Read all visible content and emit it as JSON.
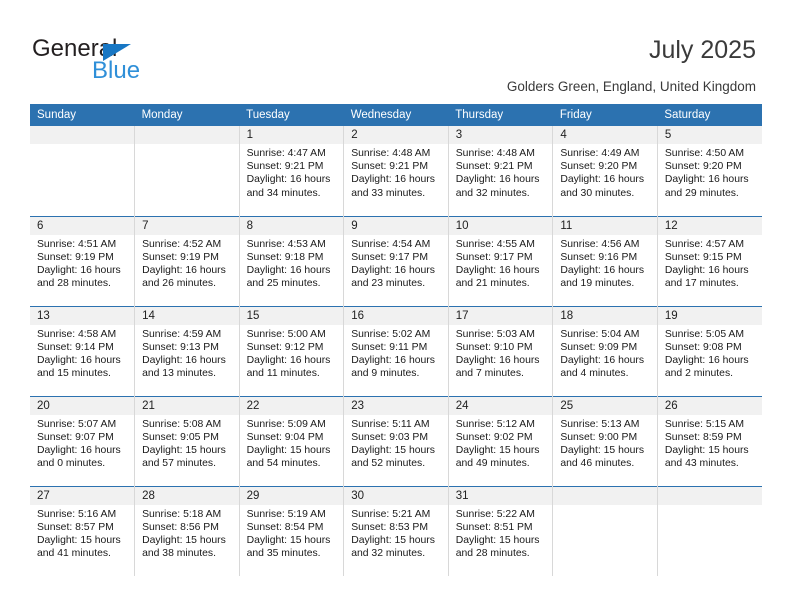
{
  "brand": {
    "name_top": "General",
    "name_bottom": "Blue",
    "triangle_icon": "blue-triangle-logo-icon",
    "color_dark": "#231f20",
    "color_blue": "#2f8fd8"
  },
  "header": {
    "title": "July 2025",
    "subtitle": "Golders Green, England, United Kingdom"
  },
  "theme": {
    "header_blue": "#2c72b0",
    "daynum_band": "#f1f1f1",
    "cell_border": "#d8d8d8"
  },
  "calendar": {
    "weekday_headers": [
      "Sunday",
      "Monday",
      "Tuesday",
      "Wednesday",
      "Thursday",
      "Friday",
      "Saturday"
    ],
    "weeks": [
      [
        {
          "day": "",
          "blank": true,
          "sunrise": "",
          "sunset": "",
          "daylight_1": "",
          "daylight_2": ""
        },
        {
          "day": "",
          "blank": true,
          "sunrise": "",
          "sunset": "",
          "daylight_1": "",
          "daylight_2": ""
        },
        {
          "day": "1",
          "blank": false,
          "sunrise": "Sunrise: 4:47 AM",
          "sunset": "Sunset: 9:21 PM",
          "daylight_1": "Daylight: 16 hours",
          "daylight_2": "and 34 minutes."
        },
        {
          "day": "2",
          "blank": false,
          "sunrise": "Sunrise: 4:48 AM",
          "sunset": "Sunset: 9:21 PM",
          "daylight_1": "Daylight: 16 hours",
          "daylight_2": "and 33 minutes."
        },
        {
          "day": "3",
          "blank": false,
          "sunrise": "Sunrise: 4:48 AM",
          "sunset": "Sunset: 9:21 PM",
          "daylight_1": "Daylight: 16 hours",
          "daylight_2": "and 32 minutes."
        },
        {
          "day": "4",
          "blank": false,
          "sunrise": "Sunrise: 4:49 AM",
          "sunset": "Sunset: 9:20 PM",
          "daylight_1": "Daylight: 16 hours",
          "daylight_2": "and 30 minutes."
        },
        {
          "day": "5",
          "blank": false,
          "sunrise": "Sunrise: 4:50 AM",
          "sunset": "Sunset: 9:20 PM",
          "daylight_1": "Daylight: 16 hours",
          "daylight_2": "and 29 minutes."
        }
      ],
      [
        {
          "day": "6",
          "blank": false,
          "sunrise": "Sunrise: 4:51 AM",
          "sunset": "Sunset: 9:19 PM",
          "daylight_1": "Daylight: 16 hours",
          "daylight_2": "and 28 minutes."
        },
        {
          "day": "7",
          "blank": false,
          "sunrise": "Sunrise: 4:52 AM",
          "sunset": "Sunset: 9:19 PM",
          "daylight_1": "Daylight: 16 hours",
          "daylight_2": "and 26 minutes."
        },
        {
          "day": "8",
          "blank": false,
          "sunrise": "Sunrise: 4:53 AM",
          "sunset": "Sunset: 9:18 PM",
          "daylight_1": "Daylight: 16 hours",
          "daylight_2": "and 25 minutes."
        },
        {
          "day": "9",
          "blank": false,
          "sunrise": "Sunrise: 4:54 AM",
          "sunset": "Sunset: 9:17 PM",
          "daylight_1": "Daylight: 16 hours",
          "daylight_2": "and 23 minutes."
        },
        {
          "day": "10",
          "blank": false,
          "sunrise": "Sunrise: 4:55 AM",
          "sunset": "Sunset: 9:17 PM",
          "daylight_1": "Daylight: 16 hours",
          "daylight_2": "and 21 minutes."
        },
        {
          "day": "11",
          "blank": false,
          "sunrise": "Sunrise: 4:56 AM",
          "sunset": "Sunset: 9:16 PM",
          "daylight_1": "Daylight: 16 hours",
          "daylight_2": "and 19 minutes."
        },
        {
          "day": "12",
          "blank": false,
          "sunrise": "Sunrise: 4:57 AM",
          "sunset": "Sunset: 9:15 PM",
          "daylight_1": "Daylight: 16 hours",
          "daylight_2": "and 17 minutes."
        }
      ],
      [
        {
          "day": "13",
          "blank": false,
          "sunrise": "Sunrise: 4:58 AM",
          "sunset": "Sunset: 9:14 PM",
          "daylight_1": "Daylight: 16 hours",
          "daylight_2": "and 15 minutes."
        },
        {
          "day": "14",
          "blank": false,
          "sunrise": "Sunrise: 4:59 AM",
          "sunset": "Sunset: 9:13 PM",
          "daylight_1": "Daylight: 16 hours",
          "daylight_2": "and 13 minutes."
        },
        {
          "day": "15",
          "blank": false,
          "sunrise": "Sunrise: 5:00 AM",
          "sunset": "Sunset: 9:12 PM",
          "daylight_1": "Daylight: 16 hours",
          "daylight_2": "and 11 minutes."
        },
        {
          "day": "16",
          "blank": false,
          "sunrise": "Sunrise: 5:02 AM",
          "sunset": "Sunset: 9:11 PM",
          "daylight_1": "Daylight: 16 hours",
          "daylight_2": "and 9 minutes."
        },
        {
          "day": "17",
          "blank": false,
          "sunrise": "Sunrise: 5:03 AM",
          "sunset": "Sunset: 9:10 PM",
          "daylight_1": "Daylight: 16 hours",
          "daylight_2": "and 7 minutes."
        },
        {
          "day": "18",
          "blank": false,
          "sunrise": "Sunrise: 5:04 AM",
          "sunset": "Sunset: 9:09 PM",
          "daylight_1": "Daylight: 16 hours",
          "daylight_2": "and 4 minutes."
        },
        {
          "day": "19",
          "blank": false,
          "sunrise": "Sunrise: 5:05 AM",
          "sunset": "Sunset: 9:08 PM",
          "daylight_1": "Daylight: 16 hours",
          "daylight_2": "and 2 minutes."
        }
      ],
      [
        {
          "day": "20",
          "blank": false,
          "sunrise": "Sunrise: 5:07 AM",
          "sunset": "Sunset: 9:07 PM",
          "daylight_1": "Daylight: 16 hours",
          "daylight_2": "and 0 minutes."
        },
        {
          "day": "21",
          "blank": false,
          "sunrise": "Sunrise: 5:08 AM",
          "sunset": "Sunset: 9:05 PM",
          "daylight_1": "Daylight: 15 hours",
          "daylight_2": "and 57 minutes."
        },
        {
          "day": "22",
          "blank": false,
          "sunrise": "Sunrise: 5:09 AM",
          "sunset": "Sunset: 9:04 PM",
          "daylight_1": "Daylight: 15 hours",
          "daylight_2": "and 54 minutes."
        },
        {
          "day": "23",
          "blank": false,
          "sunrise": "Sunrise: 5:11 AM",
          "sunset": "Sunset: 9:03 PM",
          "daylight_1": "Daylight: 15 hours",
          "daylight_2": "and 52 minutes."
        },
        {
          "day": "24",
          "blank": false,
          "sunrise": "Sunrise: 5:12 AM",
          "sunset": "Sunset: 9:02 PM",
          "daylight_1": "Daylight: 15 hours",
          "daylight_2": "and 49 minutes."
        },
        {
          "day": "25",
          "blank": false,
          "sunrise": "Sunrise: 5:13 AM",
          "sunset": "Sunset: 9:00 PM",
          "daylight_1": "Daylight: 15 hours",
          "daylight_2": "and 46 minutes."
        },
        {
          "day": "26",
          "blank": false,
          "sunrise": "Sunrise: 5:15 AM",
          "sunset": "Sunset: 8:59 PM",
          "daylight_1": "Daylight: 15 hours",
          "daylight_2": "and 43 minutes."
        }
      ],
      [
        {
          "day": "27",
          "blank": false,
          "sunrise": "Sunrise: 5:16 AM",
          "sunset": "Sunset: 8:57 PM",
          "daylight_1": "Daylight: 15 hours",
          "daylight_2": "and 41 minutes."
        },
        {
          "day": "28",
          "blank": false,
          "sunrise": "Sunrise: 5:18 AM",
          "sunset": "Sunset: 8:56 PM",
          "daylight_1": "Daylight: 15 hours",
          "daylight_2": "and 38 minutes."
        },
        {
          "day": "29",
          "blank": false,
          "sunrise": "Sunrise: 5:19 AM",
          "sunset": "Sunset: 8:54 PM",
          "daylight_1": "Daylight: 15 hours",
          "daylight_2": "and 35 minutes."
        },
        {
          "day": "30",
          "blank": false,
          "sunrise": "Sunrise: 5:21 AM",
          "sunset": "Sunset: 8:53 PM",
          "daylight_1": "Daylight: 15 hours",
          "daylight_2": "and 32 minutes."
        },
        {
          "day": "31",
          "blank": false,
          "sunrise": "Sunrise: 5:22 AM",
          "sunset": "Sunset: 8:51 PM",
          "daylight_1": "Daylight: 15 hours",
          "daylight_2": "and 28 minutes."
        },
        {
          "day": "",
          "blank": true,
          "sunrise": "",
          "sunset": "",
          "daylight_1": "",
          "daylight_2": ""
        },
        {
          "day": "",
          "blank": true,
          "sunrise": "",
          "sunset": "",
          "daylight_1": "",
          "daylight_2": ""
        }
      ]
    ]
  }
}
